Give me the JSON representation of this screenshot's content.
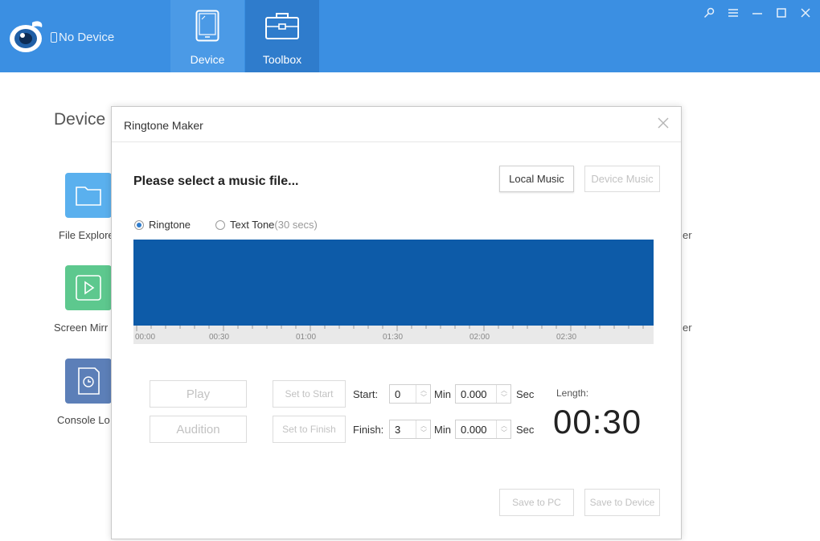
{
  "topbar": {
    "device_status": "No Device",
    "tabs": [
      {
        "label": "Device"
      },
      {
        "label": "Toolbox"
      }
    ]
  },
  "background": {
    "section_title": "Device",
    "tiles": [
      {
        "label": "File Explore",
        "color": "#5ab0ee"
      },
      {
        "label": "Screen Mirr",
        "color": "#5dc88e"
      },
      {
        "label": "Console Lo",
        "color": "#5c7fb8"
      }
    ],
    "right_labels": [
      "er",
      "er"
    ]
  },
  "dialog": {
    "title": "Ringtone Maker",
    "prompt": "Please select a music file...",
    "local_music": "Local Music",
    "device_music": "Device Music",
    "radio_ringtone": "Ringtone",
    "radio_texttone": "Text Tone",
    "radio_texttone_note": "(30 secs)",
    "timeline_labels": [
      "00:00",
      "00:30",
      "01:00",
      "01:30",
      "02:00",
      "02:30"
    ],
    "play": "Play",
    "audition": "Audition",
    "set_to_start": "Set to Start",
    "set_to_finish": "Set to Finish",
    "start_label": "Start:",
    "finish_label": "Finish:",
    "min_label": "Min",
    "sec_label": "Sec",
    "start_min": "0",
    "start_sec": "0.000",
    "finish_min": "3",
    "finish_sec": "0.000",
    "length_label": "Length:",
    "length_value": "00:30",
    "save_to_pc": "Save to PC",
    "save_to_device": "Save to Device"
  },
  "colors": {
    "topbar": "#3b8fe2",
    "waveform": "#0d5ba8",
    "radio_accent": "#2f7ccc"
  }
}
